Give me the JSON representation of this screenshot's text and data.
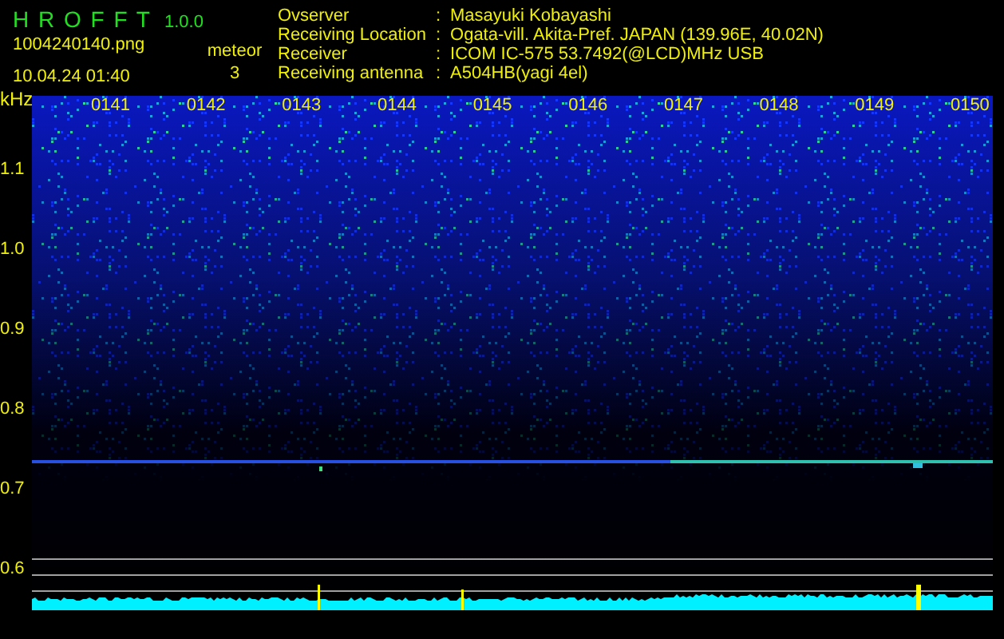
{
  "app": {
    "name": "H R O F F T",
    "version": "1.0.0"
  },
  "file": {
    "name": "1004240140.png",
    "datetime": "10.04.24 01:40"
  },
  "meteor": {
    "label": "meteor",
    "count": "3"
  },
  "info": [
    {
      "label": "Ovserver",
      "separator": ":",
      "value": "Masayuki Kobayashi"
    },
    {
      "label": "Receiving Location",
      "separator": ":",
      "value": "Ogata-vill. Akita-Pref. JAPAN (139.96E, 40.02N)"
    },
    {
      "label": "Receiver",
      "separator": ":",
      "value": "ICOM IC-575 53.7492(@LCD)MHz USB"
    },
    {
      "label": "Receiving antenna",
      "separator": ":",
      "value": "A504HB(yagi 4el)"
    }
  ],
  "plot": {
    "unit": "kHz",
    "y_labels": [
      "1.1",
      "1.0",
      "0.9",
      "0.8",
      "0.7",
      "0.6"
    ],
    "time_labels": [
      "0141",
      "0142",
      "0143",
      "0144",
      "0145",
      "0146",
      "0147",
      "0148",
      "0149",
      "0150"
    ]
  }
}
